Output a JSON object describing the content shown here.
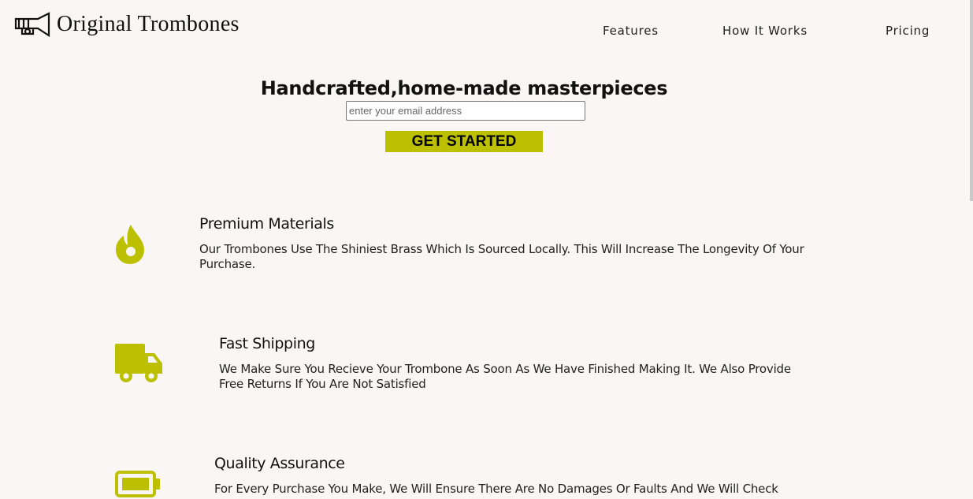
{
  "brand": {
    "name": "Original Trombones",
    "icon": "trombone-icon"
  },
  "nav": {
    "features": "Features",
    "how": "How It Works",
    "pricing": "Pricing"
  },
  "hero": {
    "title": "Handcrafted,home-made masterpieces",
    "email_placeholder": "enter your email address",
    "cta": "GET STARTED"
  },
  "colors": {
    "accent": "#bcc000",
    "background": "#f9f6f5"
  },
  "features": [
    {
      "icon": "fire-icon",
      "title": "Premium Materials",
      "text": "Our Trombones Use The Shiniest Brass Which Is Sourced Locally. This Will Increase The Longevity Of Your Purchase."
    },
    {
      "icon": "truck-icon",
      "title": "Fast Shipping",
      "text": "We Make Sure You Recieve Your Trombone As Soon As We Have Finished Making It. We Also Provide Free Returns If You Are Not Satisfied"
    },
    {
      "icon": "battery-full-icon",
      "title": "Quality Assurance",
      "text": "For Every Purchase You Make, We Will Ensure There Are No Damages Or Faults And We Will Check"
    }
  ]
}
